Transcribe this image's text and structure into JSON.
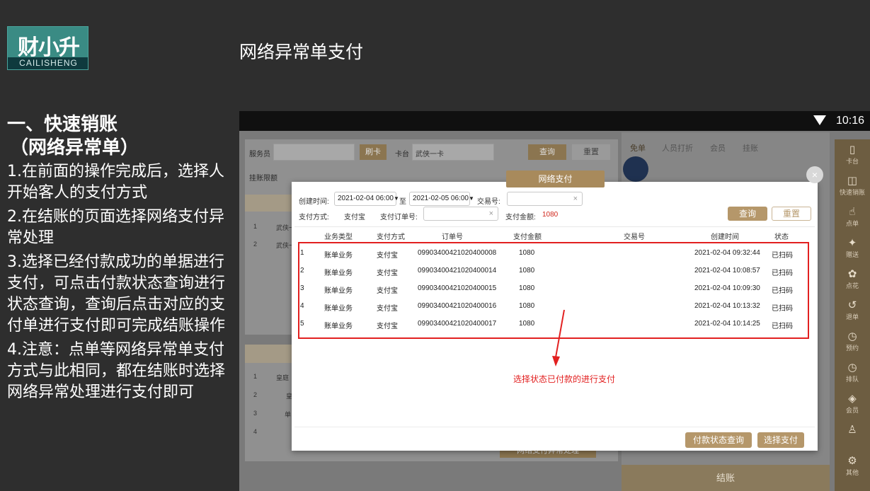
{
  "logo": {
    "mark": "财小升",
    "sub": "CAILISHENG"
  },
  "slide": {
    "title": "网络异常单支付",
    "heading1": "一、快速销账",
    "heading2": "（网络异常单）",
    "points": [
      "1.在前面的操作完成后，选择人开始客人的支付方式",
      "2.在结账的页面选择网络支付异常处理",
      "3.选择已经付款成功的单据进行支付，可点击付款状态查询进行状态查询，查询后点击对应的支付单进行支付即可完成结账操作",
      "4.注意：点单等网络异常单支付方式与此相同，都在结账时选择网络异常处理进行支付即可"
    ]
  },
  "statusbar": {
    "time": "10:16"
  },
  "background": {
    "waiter_label": "服务员",
    "card_btn": "刷卡",
    "table_label": "卡台",
    "table_value": "武侠一卡",
    "query_btn": "查询",
    "reset_btn": "重置",
    "limit_label": "挂账限额",
    "tabs": [
      "免单",
      "人员打折",
      "会员",
      "挂账"
    ],
    "rows_top": [
      "1",
      "2"
    ],
    "rows_top_text": [
      "武侠一卡",
      "武侠一卡"
    ],
    "rows_bottom": [
      "1",
      "2",
      "3",
      "4"
    ],
    "rows_bottom_text": [
      "皇庭",
      "皇",
      "单",
      ""
    ],
    "settle_btn": "结账",
    "exception_btn": "网络支付异常处理"
  },
  "sidebar": {
    "items": [
      {
        "icon": "▯",
        "label": "卡台"
      },
      {
        "icon": "◫",
        "label": "快速销账"
      },
      {
        "icon": "☝",
        "label": "点单"
      },
      {
        "icon": "✦",
        "label": "赠送"
      },
      {
        "icon": "✿",
        "label": "点花"
      },
      {
        "icon": "↺",
        "label": "退单"
      },
      {
        "icon": "◷",
        "label": "预约"
      },
      {
        "icon": "◷",
        "label": "排队"
      },
      {
        "icon": "◈",
        "label": "会员"
      },
      {
        "icon": "♙",
        "label": ""
      },
      {
        "icon": "⚙",
        "label": "其他"
      }
    ]
  },
  "dialog": {
    "title": "网络支付",
    "close": "×",
    "filters": {
      "create_time_label": "创建时间:",
      "start_date": "2021-02-04 06:00",
      "to_label": "至",
      "end_date": "2021-02-05 06:00",
      "trade_no_label": "交易号:",
      "trade_no_value": "",
      "pay_method_label": "支付方式:",
      "pay_method_value": "支付宝",
      "pay_order_label": "支付订单号:",
      "pay_order_value": "",
      "amount_label": "支付金额:",
      "amount_value": "1080"
    },
    "query_btn": "查询",
    "reset_btn": "重置",
    "columns": [
      "业务类型",
      "支付方式",
      "订单号",
      "支付金额",
      "交易号",
      "创建时间",
      "状态"
    ],
    "rows": [
      {
        "no": "1",
        "type": "账单业务",
        "pay": "支付宝",
        "order": "09903400421020400008",
        "amount": "1080",
        "trade": "",
        "time": "2021-02-04 09:32:44",
        "status": "已扫码"
      },
      {
        "no": "2",
        "type": "账单业务",
        "pay": "支付宝",
        "order": "09903400421020400014",
        "amount": "1080",
        "trade": "",
        "time": "2021-02-04 10:08:57",
        "status": "已扫码"
      },
      {
        "no": "3",
        "type": "账单业务",
        "pay": "支付宝",
        "order": "09903400421020400015",
        "amount": "1080",
        "trade": "",
        "time": "2021-02-04 10:09:30",
        "status": "已扫码"
      },
      {
        "no": "4",
        "type": "账单业务",
        "pay": "支付宝",
        "order": "09903400421020400016",
        "amount": "1080",
        "trade": "",
        "time": "2021-02-04 10:13:32",
        "status": "已扫码"
      },
      {
        "no": "5",
        "type": "账单业务",
        "pay": "支付宝",
        "order": "09903400421020400017",
        "amount": "1080",
        "trade": "",
        "time": "2021-02-04 10:14:25",
        "status": "已扫码"
      }
    ],
    "pay_status_btn": "付款状态查询",
    "select_pay_btn": "选择支付"
  },
  "annotation": {
    "note": "选择状态已付款的进行支付",
    "color": "#e22020"
  }
}
